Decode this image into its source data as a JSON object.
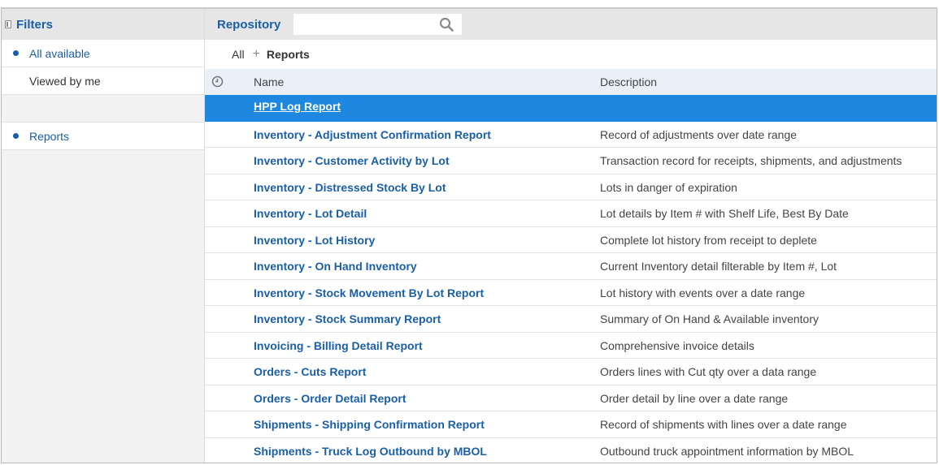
{
  "sidebar": {
    "title": "Filters",
    "items": [
      {
        "label": "All available"
      },
      {
        "label": "Viewed by me"
      },
      {
        "label": "Reports"
      }
    ]
  },
  "header": {
    "title": "Repository",
    "search": {
      "value": "",
      "placeholder": ""
    }
  },
  "breadcrumb": {
    "root": "All",
    "separator": "+",
    "current": "Reports"
  },
  "table": {
    "columns": {
      "name": "Name",
      "description": "Description"
    },
    "rows": [
      {
        "name": "HPP Log Report",
        "description": ""
      },
      {
        "name": "Inventory - Adjustment Confirmation Report",
        "description": "Record of adjustments over date range"
      },
      {
        "name": "Inventory - Customer Activity by Lot",
        "description": "Transaction record for receipts, shipments, and adjustments"
      },
      {
        "name": "Inventory - Distressed Stock By Lot",
        "description": "Lots in danger of expiration"
      },
      {
        "name": "Inventory - Lot Detail",
        "description": "Lot details by Item # with Shelf Life, Best By Date"
      },
      {
        "name": "Inventory - Lot History",
        "description": "Complete lot history from receipt to deplete"
      },
      {
        "name": "Inventory - On Hand Inventory",
        "description": "Current Inventory detail filterable by Item #, Lot"
      },
      {
        "name": "Inventory - Stock Movement By Lot Report",
        "description": "Lot history with events over a date range"
      },
      {
        "name": "Inventory - Stock Summary Report",
        "description": "Summary of On Hand & Available inventory"
      },
      {
        "name": "Invoicing - Billing Detail Report",
        "description": "Comprehensive invoice details"
      },
      {
        "name": "Orders - Cuts Report",
        "description": "Orders lines with Cut qty over a data range"
      },
      {
        "name": "Orders - Order Detail Report",
        "description": "Order detail by line over a date range"
      },
      {
        "name": "Shipments - Shipping Confirmation Report",
        "description": "Record of shipments with lines over a date range"
      },
      {
        "name": "Shipments - Truck Log Outbound by MBOL",
        "description": "Outbound truck appointment information by MBOL"
      }
    ]
  },
  "colors": {
    "accent": "#1a5fa6",
    "selected_row": "#1e88e0",
    "header_bg": "#e6e6e6",
    "table_header_bg": "#e9f0f8"
  },
  "icons": {
    "sidebar_toggle": "panel-icon",
    "search": "search-icon",
    "sort": "clock-icon",
    "breadcrumb_separator": "plus-icon"
  }
}
